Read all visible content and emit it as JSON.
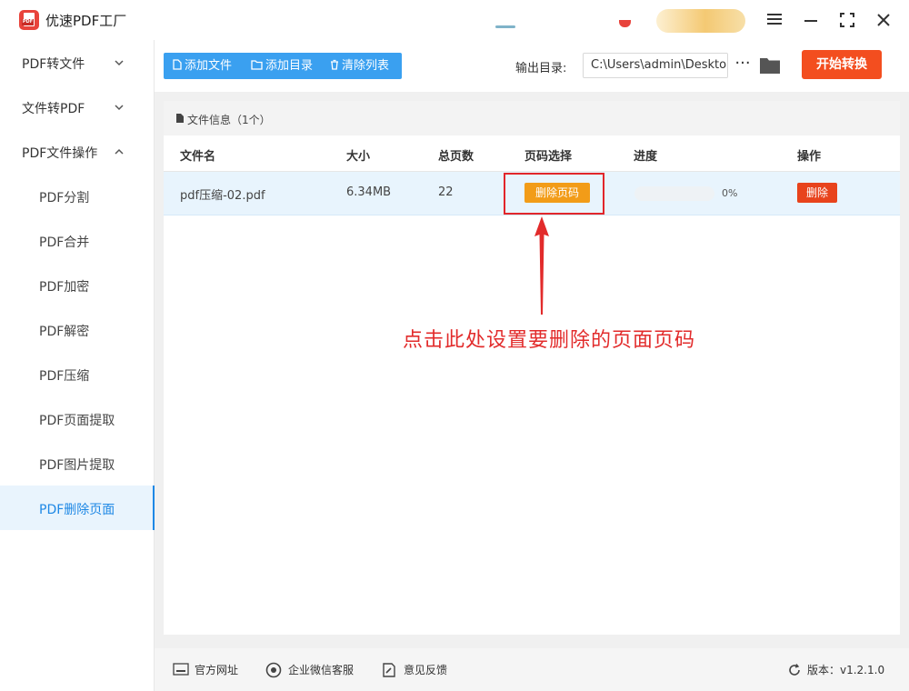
{
  "app": {
    "title": "优速PDF工厂",
    "logo_tag": "PDF"
  },
  "window_controls": [
    "menu",
    "minimize",
    "maximize",
    "close"
  ],
  "sidebar": {
    "groups": [
      {
        "label": "PDF转文件",
        "expanded": false
      },
      {
        "label": "文件转PDF",
        "expanded": false
      },
      {
        "label": "PDF文件操作",
        "expanded": true
      }
    ],
    "items": [
      {
        "label": "PDF分割",
        "active": false
      },
      {
        "label": "PDF合并",
        "active": false
      },
      {
        "label": "PDF加密",
        "active": false
      },
      {
        "label": "PDF解密",
        "active": false
      },
      {
        "label": "PDF压缩",
        "active": false
      },
      {
        "label": "PDF页面提取",
        "active": false
      },
      {
        "label": "PDF图片提取",
        "active": false
      },
      {
        "label": "PDF删除页面",
        "active": true
      }
    ]
  },
  "toolbar": {
    "add_file": "添加文件",
    "add_folder": "添加目录",
    "clear_list": "清除列表",
    "output_label": "输出目录:",
    "output_path": "C:\\Users\\admin\\Desktop",
    "more": "···",
    "start": "开始转换"
  },
  "file_info": {
    "label": "文件信息（1个）"
  },
  "table": {
    "headers": {
      "name": "文件名",
      "size": "大小",
      "pages": "总页数",
      "page_select": "页码选择",
      "progress": "进度",
      "action": "操作"
    },
    "rows": [
      {
        "name": "pdf压缩-02.pdf",
        "size": "6.34MB",
        "pages": "22",
        "page_select_button": "删除页码",
        "progress": 0,
        "progress_label": "0%",
        "delete_button": "删除"
      }
    ]
  },
  "annotation": {
    "text": "点击此处设置要删除的页面页码"
  },
  "footer": {
    "website": "官方网址",
    "wechat": "企业微信客服",
    "feedback": "意见反馈",
    "version": "版本：v1.2.1.0"
  },
  "colors": {
    "accent": "#1e88e5",
    "toolbar_blue": "#3aa0f0",
    "start": "#f34e1f",
    "pick": "#f29c18",
    "delete": "#e8431c",
    "annotation": "#e22b2b"
  }
}
